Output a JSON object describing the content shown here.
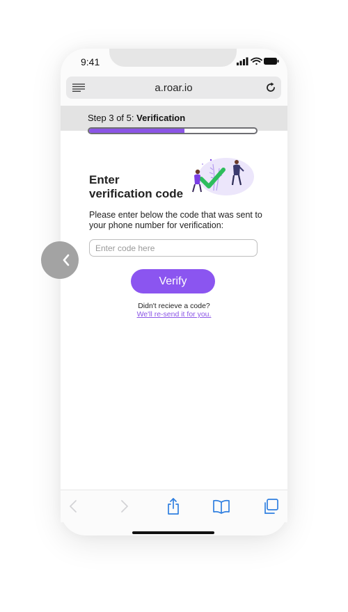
{
  "status": {
    "time": "9:41"
  },
  "browser": {
    "url": "a.roar.io",
    "icons": [
      "menu-icon",
      "reload-icon",
      "back-arrow-icon",
      "forward-arrow-icon",
      "share-icon",
      "bookmarks-icon",
      "tabs-icon"
    ]
  },
  "step": {
    "prefix": "Step 3 of 5: ",
    "name": "Verification",
    "progress_fraction": 0.57
  },
  "form": {
    "title_line1": "Enter",
    "title_line2": "verification code",
    "description": "Please enter below the code that was sent to your phone number for verification:",
    "input_placeholder": "Enter code here",
    "input_value": "",
    "verify_label": "Verify",
    "resend_question": "Didn't recieve a code?",
    "resend_link": "We'll re-send it for you."
  },
  "colors": {
    "accent": "#8b55f0",
    "progress_border": "#6e6e73",
    "check": "#2dbd5c"
  }
}
